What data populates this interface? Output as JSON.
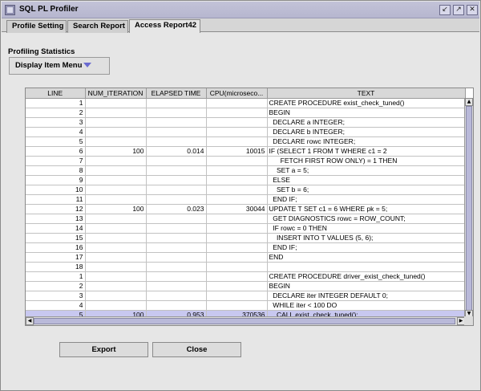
{
  "window": {
    "title": "SQL PL Profiler",
    "controls": [
      "minimize-icon",
      "maximize-icon",
      "close-icon"
    ]
  },
  "tabs": [
    {
      "label": "Profile Setting",
      "active": false
    },
    {
      "label": "Search Report",
      "active": false
    },
    {
      "label": "Access Report42",
      "active": true
    }
  ],
  "section_label": "Profiling Statistics",
  "display_menu": {
    "label": "Display Item Menu"
  },
  "table": {
    "columns": [
      "LINE",
      "NUM_ITERATION",
      "ELAPSED TIME",
      "CPU(microseco...",
      "TEXT"
    ],
    "rows": [
      {
        "line": "1",
        "iter": "",
        "elapsed": "",
        "cpu": "",
        "text": "CREATE PROCEDURE exist_check_tuned()"
      },
      {
        "line": "2",
        "iter": "",
        "elapsed": "",
        "cpu": "",
        "text": "BEGIN"
      },
      {
        "line": "3",
        "iter": "",
        "elapsed": "",
        "cpu": "",
        "text": "  DECLARE a INTEGER;"
      },
      {
        "line": "4",
        "iter": "",
        "elapsed": "",
        "cpu": "",
        "text": "  DECLARE b INTEGER;"
      },
      {
        "line": "5",
        "iter": "",
        "elapsed": "",
        "cpu": "",
        "text": "  DECLARE rowc INTEGER;"
      },
      {
        "line": "6",
        "iter": "100",
        "elapsed": "0.014",
        "cpu": "10015",
        "text": "IF (SELECT 1 FROM T WHERE c1 = 2"
      },
      {
        "line": "7",
        "iter": "",
        "elapsed": "",
        "cpu": "",
        "text": "      FETCH FIRST ROW ONLY) = 1 THEN"
      },
      {
        "line": "8",
        "iter": "",
        "elapsed": "",
        "cpu": "",
        "text": "    SET a = 5;"
      },
      {
        "line": "9",
        "iter": "",
        "elapsed": "",
        "cpu": "",
        "text": "  ELSE"
      },
      {
        "line": "10",
        "iter": "",
        "elapsed": "",
        "cpu": "",
        "text": "    SET b = 6;"
      },
      {
        "line": "11",
        "iter": "",
        "elapsed": "",
        "cpu": "",
        "text": "  END IF;"
      },
      {
        "line": "12",
        "iter": "100",
        "elapsed": "0.023",
        "cpu": "30044",
        "text": "UPDATE T SET c1 = 6 WHERE pk = 5;"
      },
      {
        "line": "13",
        "iter": "",
        "elapsed": "",
        "cpu": "",
        "text": "  GET DIAGNOSTICS rowc = ROW_COUNT;"
      },
      {
        "line": "14",
        "iter": "",
        "elapsed": "",
        "cpu": "",
        "text": "  IF rowc = 0 THEN"
      },
      {
        "line": "15",
        "iter": "",
        "elapsed": "",
        "cpu": "",
        "text": "    INSERT INTO T VALUES (5, 6);"
      },
      {
        "line": "16",
        "iter": "",
        "elapsed": "",
        "cpu": "",
        "text": "  END IF;"
      },
      {
        "line": "17",
        "iter": "",
        "elapsed": "",
        "cpu": "",
        "text": "END"
      },
      {
        "line": "18",
        "iter": "",
        "elapsed": "",
        "cpu": "",
        "text": ""
      },
      {
        "line": "1",
        "iter": "",
        "elapsed": "",
        "cpu": "",
        "text": "CREATE PROCEDURE driver_exist_check_tuned()"
      },
      {
        "line": "2",
        "iter": "",
        "elapsed": "",
        "cpu": "",
        "text": "BEGIN"
      },
      {
        "line": "3",
        "iter": "",
        "elapsed": "",
        "cpu": "",
        "text": "  DECLARE iter INTEGER DEFAULT 0;"
      },
      {
        "line": "4",
        "iter": "",
        "elapsed": "",
        "cpu": "",
        "text": "  WHILE iter < 100 DO"
      },
      {
        "line": "5",
        "iter": "100",
        "elapsed": "0.953",
        "cpu": "370536",
        "text": "    CALL exist_check_tuned();",
        "selected": true
      }
    ]
  },
  "buttons": {
    "export": "Export",
    "close": "Close"
  }
}
